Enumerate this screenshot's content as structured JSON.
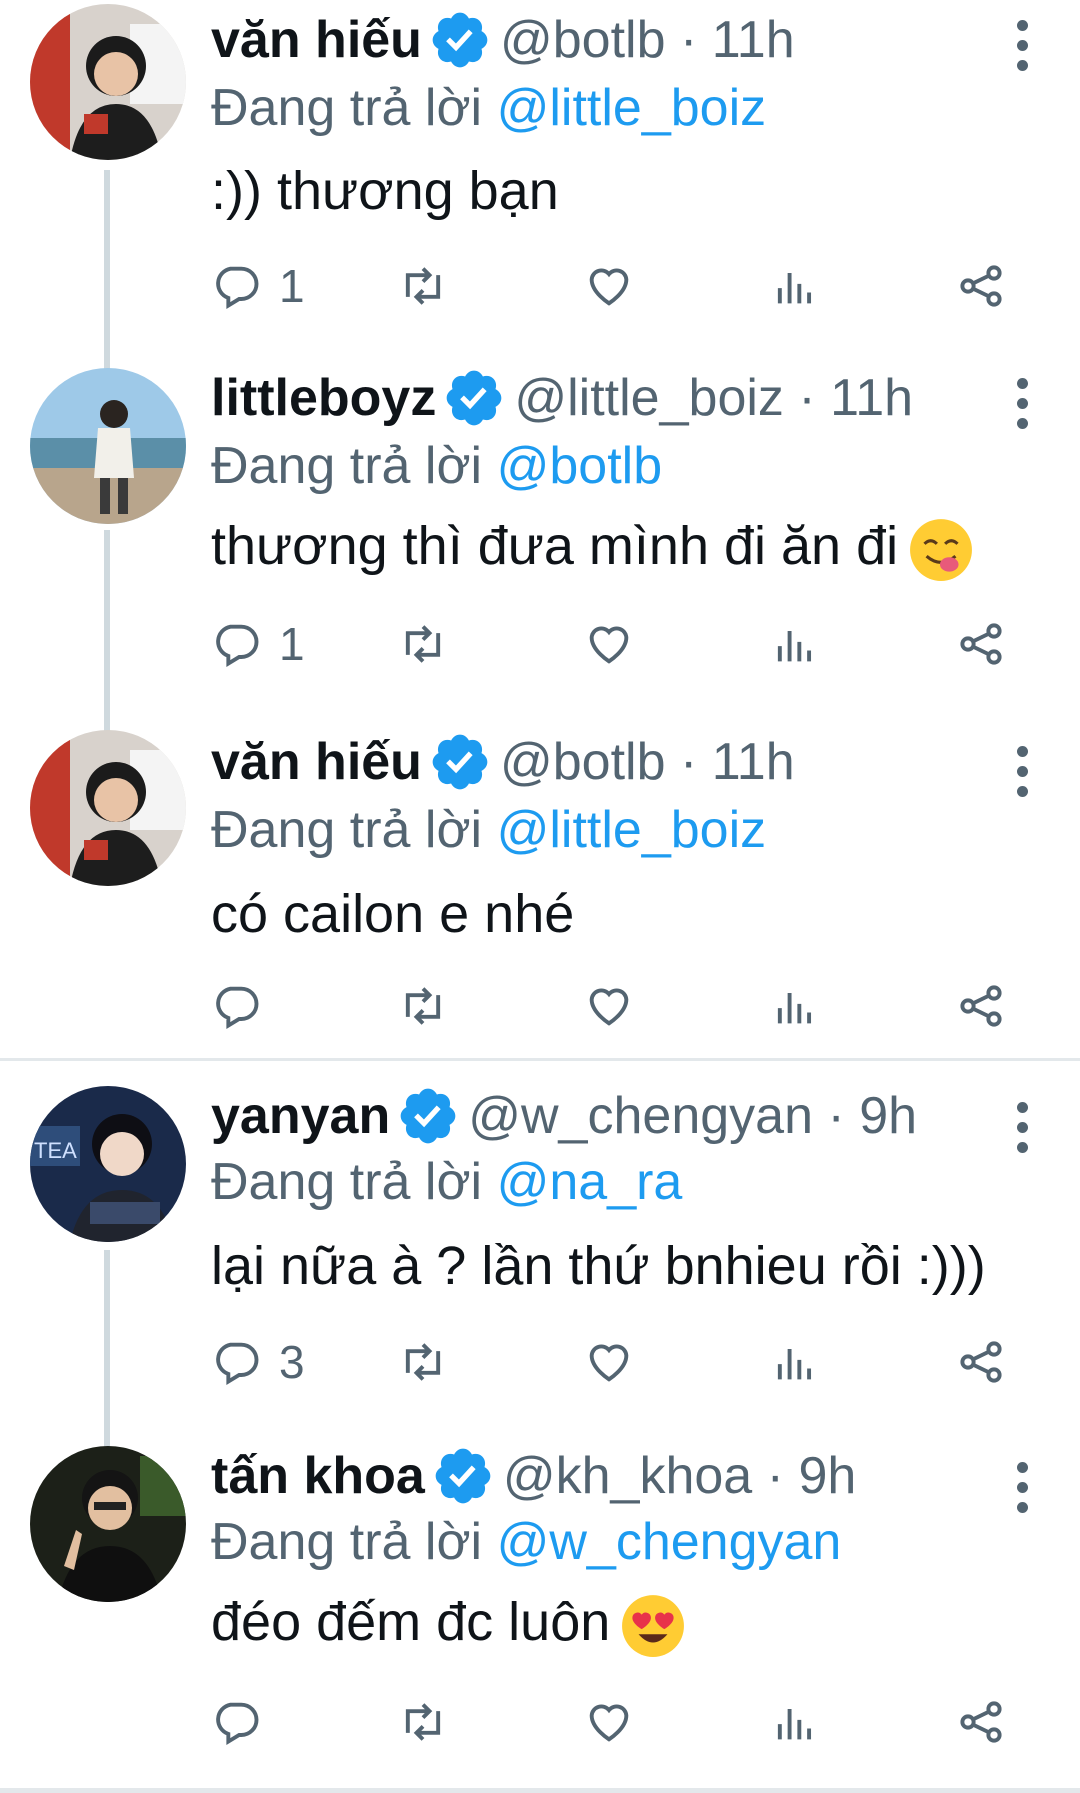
{
  "colors": {
    "accent": "#1d9bf0",
    "muted": "#536471",
    "text": "#0f1419",
    "line": "#cfd9de"
  },
  "reply_prefix": "Đang trả lời",
  "tweets": [
    {
      "name": "văn hiếu",
      "handle": "@botlb",
      "sep": " · ",
      "time": "11h",
      "reply_to": "@little_boiz",
      "text": ":)) thương bạn",
      "emoji": "",
      "reply_count": "1",
      "avatar": "avatar-vanhieu"
    },
    {
      "name": "littleboyz",
      "handle": "@little_boiz",
      "sep": " · ",
      "time": "11h",
      "reply_to": "@botlb",
      "text": "thương thì đưa mình đi ăn đi",
      "emoji": "yum-face-emoji",
      "reply_count": "1",
      "avatar": "avatar-littleboyz"
    },
    {
      "name": "văn hiếu",
      "handle": "@botlb",
      "sep": " · ",
      "time": "11h",
      "reply_to": "@little_boiz",
      "text": "có cailon e nhé",
      "emoji": "",
      "reply_count": "",
      "avatar": "avatar-vanhieu"
    },
    {
      "name": "yanyan",
      "handle": "@w_chengyan",
      "sep": " · ",
      "time": "9h",
      "reply_to": "@na_ra",
      "text": "lại nữa à ? lần thứ bnhieu rồi :)))",
      "emoji": "",
      "reply_count": "3",
      "avatar": "avatar-yanyan"
    },
    {
      "name": "tấn khoa",
      "handle": "@kh_khoa",
      "sep": " · ",
      "time": "9h",
      "reply_to": "@w_chengyan",
      "text": "đéo đếm đc luôn",
      "emoji": "heart-eyes-emoji",
      "reply_count": "",
      "avatar": "avatar-tankhoa"
    }
  ]
}
